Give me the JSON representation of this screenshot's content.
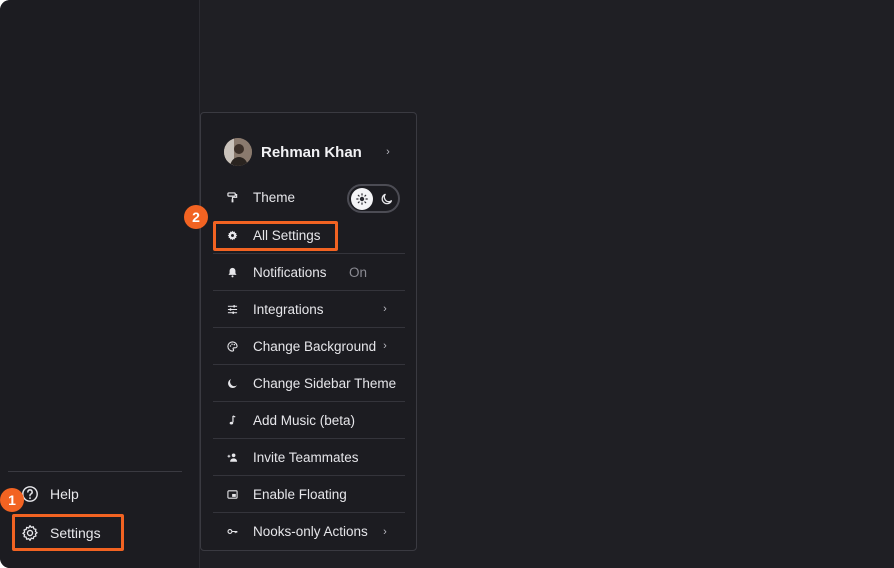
{
  "sidebar": {
    "help_label": "Help",
    "settings_label": "Settings"
  },
  "annotations": {
    "step1": "1",
    "step2": "2",
    "highlight_color": "#f26322"
  },
  "menu": {
    "profile_name": "Rehman Khan",
    "theme_label": "Theme",
    "theme_mode": "light",
    "items": [
      {
        "label": "All Settings",
        "icon": "gear-icon"
      },
      {
        "label": "Notifications",
        "icon": "bell-icon",
        "value": "On"
      },
      {
        "label": "Integrations",
        "icon": "sliders-icon",
        "has_submenu": true
      },
      {
        "label": "Change Background",
        "icon": "palette-icon",
        "has_submenu": true
      },
      {
        "label": "Change Sidebar Theme",
        "icon": "moon-icon"
      },
      {
        "label": "Add Music (beta)",
        "icon": "music-note-icon"
      },
      {
        "label": "Invite Teammates",
        "icon": "add-user-icon"
      },
      {
        "label": "Enable Floating",
        "icon": "picture-in-picture-icon"
      },
      {
        "label": "Nooks-only Actions",
        "icon": "key-icon",
        "has_submenu": true
      }
    ]
  },
  "colors": {
    "background": "#1f1f24",
    "menu_background": "#1c1c21",
    "accent": "#f26322"
  }
}
